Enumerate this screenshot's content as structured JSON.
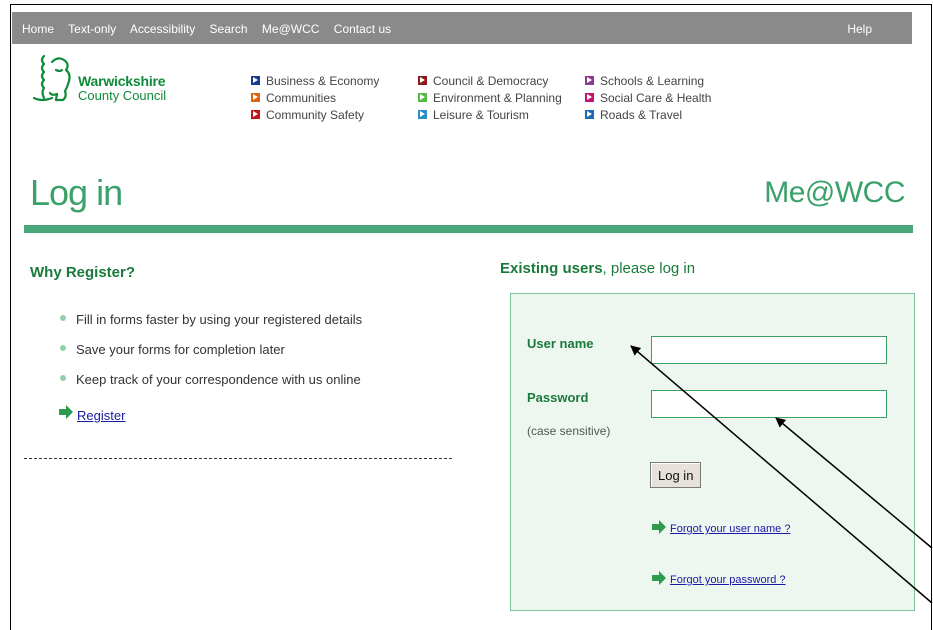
{
  "topnav": {
    "items": [
      "Home",
      "Text-only",
      "Accessibility",
      "Search",
      "Me@WCC",
      "Contact us"
    ],
    "help": "Help"
  },
  "logo": {
    "line1": "Warwickshire",
    "line2": "County Council"
  },
  "categories": [
    {
      "label": "Business & Economy",
      "color": "#1a3b8f"
    },
    {
      "label": "Communities",
      "color": "#e0620d"
    },
    {
      "label": "Community Safety",
      "color": "#c0161c"
    },
    {
      "label": "Council & Democracy",
      "color": "#8b1a1a"
    },
    {
      "label": "Environment & Planning",
      "color": "#58b84a"
    },
    {
      "label": "Leisure & Tourism",
      "color": "#2a8cc8"
    },
    {
      "label": "Schools & Learning",
      "color": "#8b3a8f"
    },
    {
      "label": "Social Care & Health",
      "color": "#c0166e"
    },
    {
      "label": "Roads & Travel",
      "color": "#1d6bb5"
    }
  ],
  "page": {
    "title": "Log in",
    "brand": "Me@WCC"
  },
  "why": {
    "heading": "Why Register?",
    "items": [
      "Fill in forms faster by using your registered details",
      "Save your forms for completion later",
      "Keep track of your correspondence with us online"
    ],
    "register_link": "Register"
  },
  "login": {
    "heading_bold": "Existing users",
    "heading_rest": ", please log in",
    "username_label": "User name",
    "password_label": "Password",
    "password_hint": "(case sensitive)",
    "username_value": "",
    "password_value": "",
    "button": "Log in",
    "forgot_username": "Forgot your user name ?",
    "forgot_password": "Forgot your password ?"
  },
  "colors": {
    "accent": "#3aa16a",
    "topbar": "#8a8a8a",
    "link": "#1a1aa6"
  }
}
